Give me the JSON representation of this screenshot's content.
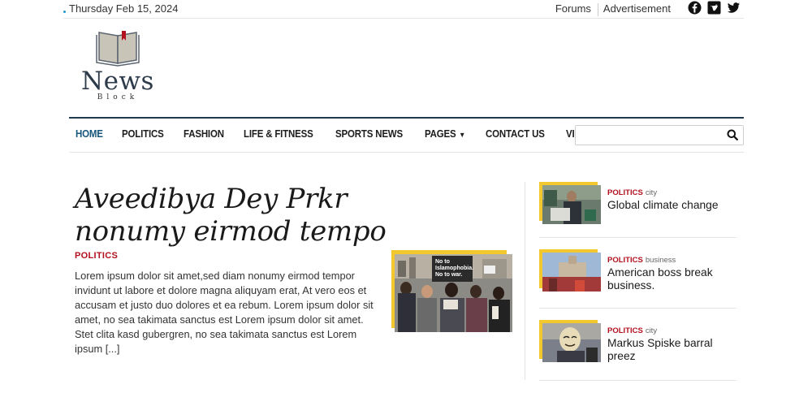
{
  "topbar": {
    "date": "Thursday Feb 15, 2024",
    "links": [
      "Forums",
      "Advertisement"
    ],
    "social_icons": [
      "facebook-icon",
      "vimeo-icon",
      "twitter-icon"
    ]
  },
  "logo": {
    "word": "News",
    "subword": "Block"
  },
  "nav": {
    "items": [
      {
        "label": "HOME",
        "active": true
      },
      {
        "label": "POLITICS"
      },
      {
        "label": "FASHION"
      },
      {
        "label": "LIFE & FITNESS"
      },
      {
        "label": "SPORTS NEWS"
      },
      {
        "label": "PAGES",
        "dropdown": true
      },
      {
        "label": "CONTACT US"
      },
      {
        "label": "VIEW PRO"
      }
    ],
    "search_placeholder": ""
  },
  "main": {
    "headline": "Aveedibya Dey Prkr nonumy eirmod tempo",
    "category": "POLITICS",
    "excerpt": "Lorem ipsum dolor sit amet,sed diam nonumy eirmod tempor invidunt ut labore et dolore magna aliquyam erat, At vero eos et accusam et justo duo dolores et ea rebum. Lorem ipsum dolor sit amet, no sea takimata sanctus est Lorem ipsum dolor sit amet. Stet clita kasd gubergren, no sea takimata sanctus est Lorem ipsum [...]",
    "image_sign_text": [
      "No to",
      "Islamophobia.",
      "No to war."
    ]
  },
  "side": [
    {
      "category": "POLITICS",
      "tag": "city",
      "title": "Global climate change"
    },
    {
      "category": "POLITICS",
      "tag": "business",
      "title": "American boss break business."
    },
    {
      "category": "POLITICS",
      "tag": "city",
      "title": "Markus Spiske barral preez"
    }
  ],
  "colors": {
    "accent_red": "#b2101e",
    "nav_border": "#1f3a4c",
    "frame_yellow": "#f3c82e",
    "home_blue": "#17567a"
  }
}
